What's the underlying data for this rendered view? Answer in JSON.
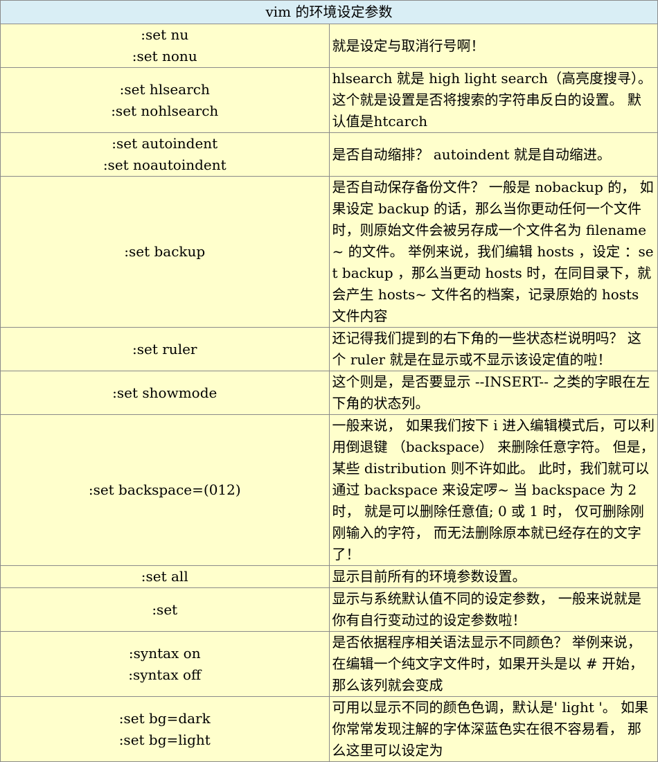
{
  "table": {
    "title": "vim 的环境设定参数",
    "rows": [
      {
        "cmds": [
          ":set nu",
          ":set nonu"
        ],
        "desc": "就是设定与取消行号啊！"
      },
      {
        "cmds": [
          ":set hlsearch",
          ":set nohlsearch"
        ],
        "desc": "hlsearch 就是 high light search（高亮度搜寻）。 这个就是设置是否将搜索的字符串反白的设置。 默认值是htcarch"
      },
      {
        "cmds": [
          ":set autoindent",
          ":set noautoindent"
        ],
        "desc": "是否自动缩排？ autoindent 就是自动缩进。"
      },
      {
        "cmds": [
          ":set backup"
        ],
        "desc": "是否自动保存备份文件？ 一般是 nobackup 的， 如果设定 backup 的话，那么当你更动任何一个文件时，则原始文件会被另存成一个文件名为 filename~ 的文件。 举例来说，我们编辑 hosts ，设定 ：set backup ，那么当更动 hosts 时，在同目录下，就会产生 hosts~ 文件名的档案，记录原始的 hosts 文件内容"
      },
      {
        "cmds": [
          ":set ruler"
        ],
        "desc": "还记得我们提到的右下角的一些状态栏说明吗？ 这个 ruler 就是在显示或不显示该设定值的啦！"
      },
      {
        "cmds": [
          ":set showmode"
        ],
        "desc": "这个则是，是否要显示 --INSERT-- 之类的字眼在左下角的状态列。"
      },
      {
        "cmds": [
          ":set backspace=(012)"
        ],
        "desc": "一般来说， 如果我们按下 i 进入编辑模式后，可以利用倒退键 （backspace） 来删除任意字符。 但是，某些 distribution 则不许如此。 此时，我们就可以通过 backspace 来设定啰~ 当 backspace 为 2 时， 就是可以删除任意值; 0 或 1 时， 仅可删除刚刚输入的字符， 而无法删除原本就已经存在的文字了！"
      },
      {
        "cmds": [
          ":set all"
        ],
        "desc": "显示目前所有的环境参数设置。"
      },
      {
        "cmds": [
          ":set"
        ],
        "desc": "显示与系统默认值不同的设定参数， 一般来说就是你有自行变动过的设定参数啦！"
      },
      {
        "cmds": [
          ":syntax on",
          ":syntax off"
        ],
        "desc": "是否依据程序相关语法显示不同颜色？ 举例来说，在编辑一个纯文字文件时，如果开头是以 # 开始，那么该列就会变成"
      },
      {
        "cmds": [
          ":set bg=dark",
          ":set bg=light"
        ],
        "desc": "可用以显示不同的颜色色调，默认是' light '。 如果你常常发现注解的字体深蓝色实在很不容易看， 那么这里可以设定为"
      }
    ]
  },
  "colors": {
    "title_bg": "#d9eef5",
    "cell_bg": "#ffffcc",
    "border": "#8a8a8a"
  }
}
